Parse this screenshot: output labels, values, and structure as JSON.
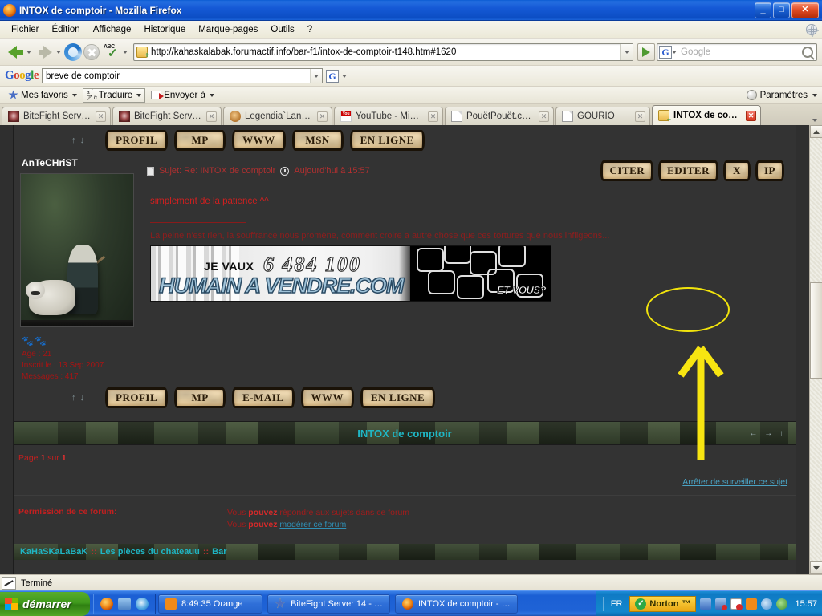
{
  "window": {
    "title": "INTOX de comptoir - Mozilla Firefox",
    "minimize": "_",
    "maximize": "□",
    "close": "✕"
  },
  "menubar": {
    "items": [
      "Fichier",
      "Édition",
      "Affichage",
      "Historique",
      "Marque-pages",
      "Outils",
      "?"
    ]
  },
  "navbar": {
    "url": "http://kahaskalabak.forumactif.info/bar-f1/intox-de-comptoir-t148.htm#1620",
    "search_placeholder": "Google",
    "back_icon": "back-arrow-icon",
    "forward_icon": "forward-arrow-icon",
    "reload_icon": "reload-icon",
    "stop_icon": "stop-icon",
    "spell_icon": "abc-spellcheck-icon",
    "go_icon": "go-arrow-icon"
  },
  "google_toolbar": {
    "logo": [
      "G",
      "o",
      "o",
      "g",
      "l",
      "e"
    ],
    "query": "breve de comptoir",
    "g_button": "G"
  },
  "bookmarks": {
    "favoris": "Mes favoris",
    "traduire": "Traduire",
    "envoyer": "Envoyer à",
    "parametres": "Paramètres"
  },
  "tabs": [
    {
      "label": "BiteFight Server…",
      "icon": "bitefight-icon",
      "active": false
    },
    {
      "label": "BiteFight Server…",
      "icon": "bitefight-icon",
      "active": false
    },
    {
      "label": "Legendia`Land …",
      "icon": "legendia-icon",
      "active": false
    },
    {
      "label": "YouTube - Minu…",
      "icon": "youtube-icon",
      "active": false
    },
    {
      "label": "PouëtPouët.co…",
      "icon": "document-icon",
      "active": false
    },
    {
      "label": "GOURIO",
      "icon": "document-icon",
      "active": false
    },
    {
      "label": "INTOX de com…",
      "icon": "forum-icon",
      "active": true
    }
  ],
  "forum": {
    "top_buttons": [
      "PROFIL",
      "MP",
      "WWW",
      "MSN",
      "EN LIGNE"
    ],
    "bottom_buttons": [
      "PROFIL",
      "MP",
      "E-MAIL",
      "WWW",
      "EN LIGNE"
    ],
    "up_arrow": "↑",
    "down_arrow": "↓",
    "poster": {
      "name": "AnTeCHriST",
      "age": "Age : 21",
      "registered": "Inscrit le : 13 Sep 2007",
      "messages": "Messages : 417",
      "avatar_alt": "avatar-warrior-with-white-tiger"
    },
    "post": {
      "subject": "Sujet: Re: INTOX de comptoir",
      "timestamp": "Aujourd'hui à 15:57",
      "body": "simplement de la patience ^^",
      "signature": "La peine n'est rien, la souffrance nous promène, comment croire a autre chose que ces tortures que nous infligeons..."
    },
    "action_buttons": [
      "CITER",
      "EDITER",
      "X",
      "IP"
    ],
    "banner": {
      "je_vaux": "JE VAUX",
      "amount": "6 484 100",
      "euro": "€",
      "site": "HUMAIN A VENDRE.COM",
      "et_vous": "ET VOUS?"
    },
    "footer_title": "INTOX de comptoir",
    "footer_arrows": "← → ↑",
    "page_label_pre": "Page ",
    "page_current": "1",
    "page_label_mid": " sur ",
    "page_total": "1",
    "watch_link": "Arrêter de surveiller ce sujet",
    "permission_title": "Permission de ce forum:",
    "permission_lines": [
      {
        "pre": "Vous ",
        "bold": "pouvez",
        "post": " répondre aux sujets dans ce forum",
        "link": ""
      },
      {
        "pre": "Vous ",
        "bold": "pouvez",
        "post": " ",
        "link": "modérer ce forum"
      }
    ],
    "breadcrumb": [
      "KaHaSKaLaBaK",
      "Les pièces du chateauu",
      "Bar"
    ],
    "breadcrumb_sep": "::"
  },
  "annotation": {
    "highlight_target": "EDITER",
    "color": "#f2e40c",
    "shapes": [
      "ellipse-highlight",
      "up-arrow-pointer"
    ]
  },
  "statusbar": {
    "text": "Terminé"
  },
  "taskbar": {
    "start": "démarrer",
    "quicklaunch": [
      "firefox-icon",
      "contacts-icon",
      "internet-explorer-icon"
    ],
    "buttons": [
      {
        "label": "8:49:35 Orange",
        "icon": "orange-icon"
      },
      {
        "label": "BiteFight Server 14 - …",
        "icon": "star-icon"
      },
      {
        "label": "INTOX de comptoir - …",
        "icon": "firefox-icon"
      }
    ],
    "language": "FR",
    "norton": "Norton",
    "norton_tm": "™",
    "tray_icons": [
      "network-icon",
      "network-error-icon",
      "shield-alert-icon",
      "orange-icon",
      "media-icon",
      "update-icon"
    ],
    "clock": "15:57"
  }
}
